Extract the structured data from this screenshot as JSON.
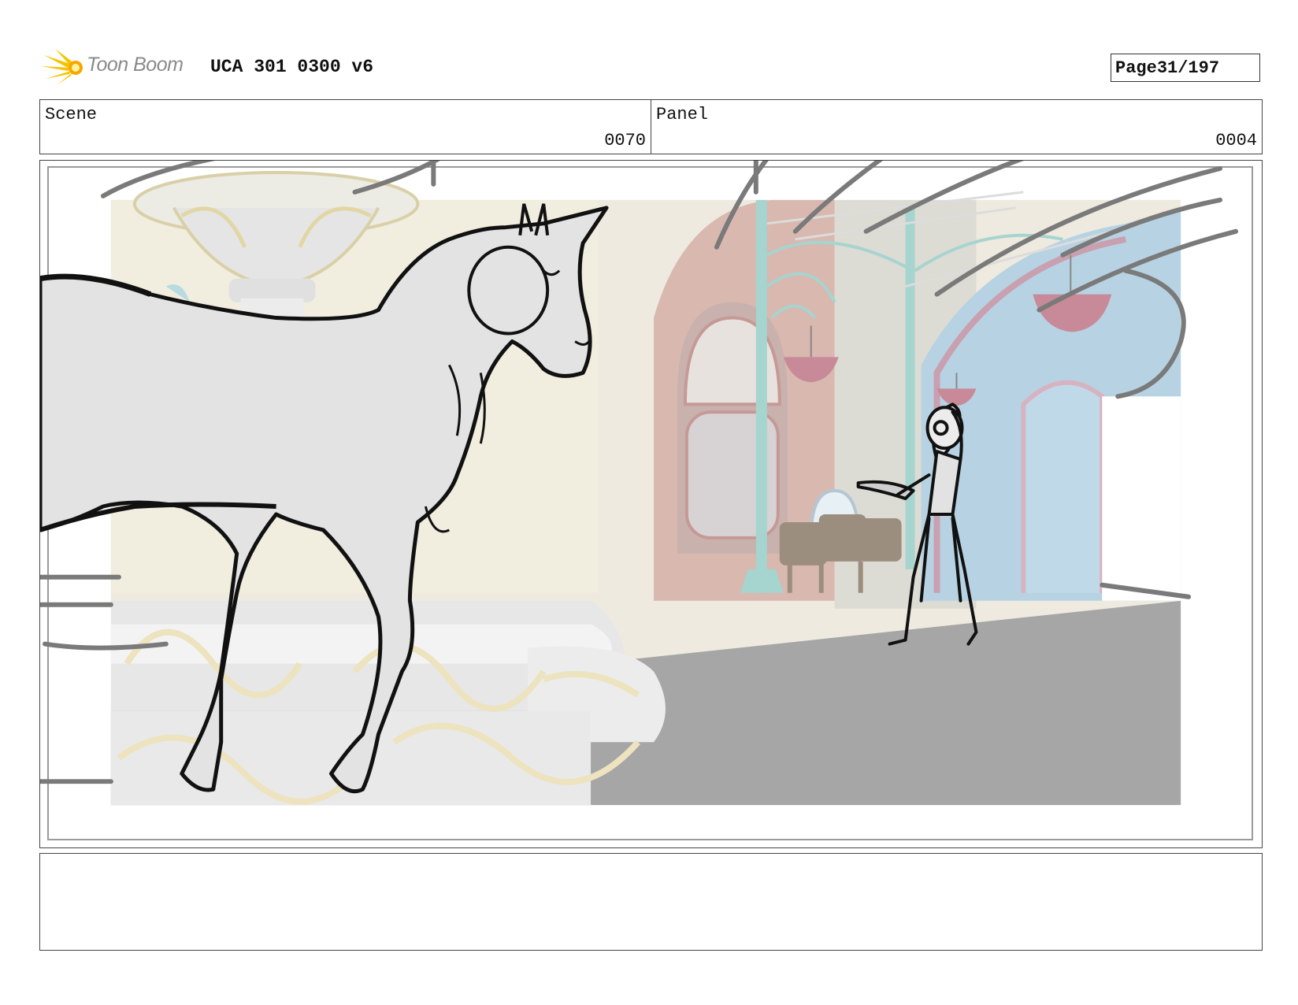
{
  "header": {
    "logo_text": "Toon Boom",
    "logo_icon": "toon-boom-burst-icon",
    "title": "UCA 301 0300 v6",
    "page_label": "Page",
    "page_number": "31/197"
  },
  "info": {
    "scene_label": "Scene",
    "scene_value": "0070",
    "panel_label": "Panel",
    "panel_value": "0004"
  },
  "notes": {
    "text": ""
  },
  "colors": {
    "accent_logo": "#f5c400",
    "floor": "#a6a6a6",
    "wall_pink": "#d9b8b0",
    "window_blue": "#b7d3e3",
    "pillar_teal": "#a6d4cf",
    "basket_pink": "#c88a98",
    "ornament_cream": "#ede3bf"
  }
}
